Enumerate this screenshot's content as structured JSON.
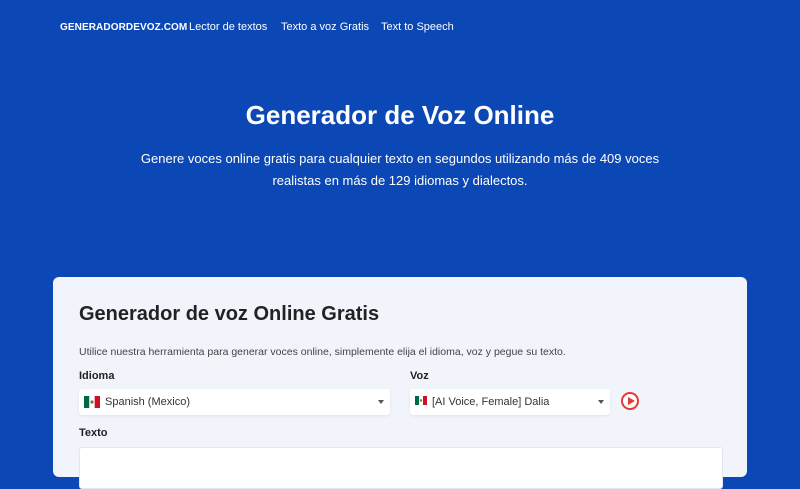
{
  "nav": {
    "brand": "GENERADORDEVOZ.COM",
    "links": [
      "Lector de textos",
      "Texto a voz Gratis",
      "Text to Speech"
    ]
  },
  "hero": {
    "title": "Generador de Voz Online",
    "subtitle_line1": "Genere voces online gratis para cualquier texto en segundos utilizando más de 409 voces",
    "subtitle_line2": "realistas en más de 129 idiomas y dialectos."
  },
  "tool": {
    "title": "Generador de voz Online Gratis",
    "description": "Utilice nuestra herramienta para generar voces online, simplemente elija el idioma, voz y pegue su texto.",
    "language_label": "Idioma",
    "language_value": "Spanish (Mexico)",
    "language_flag_icon": "mexico-flag-icon",
    "voice_label": "Voz",
    "voice_value": "[AI Voice, Female] Dalia",
    "voice_flag_icon": "mexico-flag-icon",
    "text_label": "Texto",
    "text_value": ""
  },
  "colors": {
    "background": "#0b47b5",
    "card": "#f1f4fb",
    "play_accent": "#e53935"
  }
}
